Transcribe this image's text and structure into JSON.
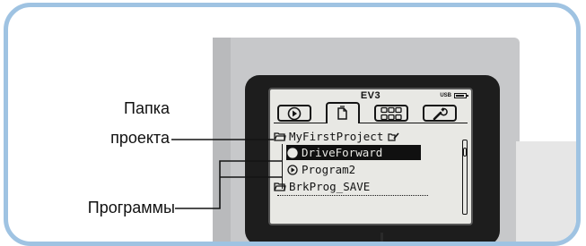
{
  "callouts": {
    "project_folder_line1": "Папка",
    "project_folder_line2": "проекта",
    "programs": "Программы"
  },
  "screen": {
    "title": "EV3",
    "usb_label": "USB",
    "battery_level": 0.85,
    "tabs": [
      {
        "icon": "run-recent-icon",
        "active": false
      },
      {
        "icon": "file-navigation-icon",
        "active": true
      },
      {
        "icon": "brick-apps-icon",
        "active": false
      },
      {
        "icon": "settings-wrench-icon",
        "active": false
      }
    ],
    "files": {
      "folder": "MyFirstProject",
      "program1": "DriveForward",
      "program2": "Program2",
      "other": "BrkProg_SAVE"
    },
    "selected_item": "DriveForward"
  },
  "colors": {
    "frame_border": "#9fc3e2",
    "lcd_background": "#e8e8e4",
    "brick_body": "#c7c8ca"
  }
}
